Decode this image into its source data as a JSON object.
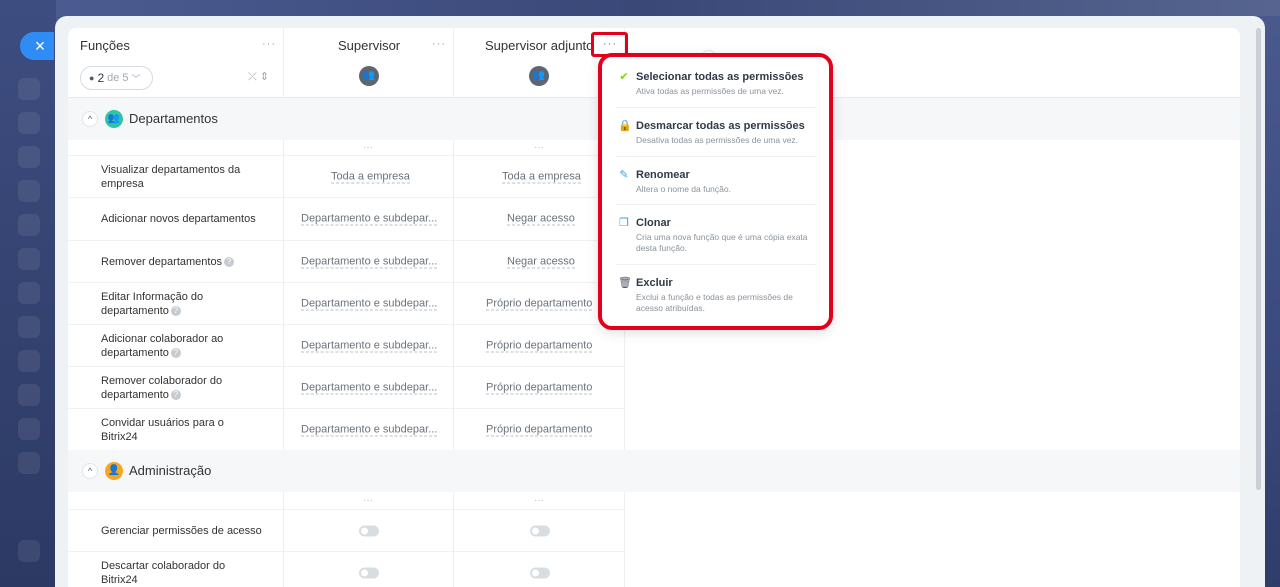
{
  "close_label": "×",
  "functions": {
    "title": "Funções",
    "counter_selected": "2",
    "counter_of": "de 5",
    "dots": "···"
  },
  "roles": [
    {
      "name": "Supervisor",
      "avatar": "people-icon"
    },
    {
      "name": "Supervisor adjunto",
      "avatar": "people-icon"
    }
  ],
  "sections": [
    {
      "label": "Departamentos",
      "icon_color": "#2fc6a4",
      "rows": [
        {
          "label": "Visualizar departamentos da empresa",
          "help": false,
          "values": [
            "Toda a empresa",
            "Toda a empresa"
          ]
        },
        {
          "label": "Adicionar novos departamentos",
          "help": false,
          "values": [
            "Departamento e subdepar...",
            "Negar acesso"
          ]
        },
        {
          "label": "Remover departamentos",
          "help": true,
          "values": [
            "Departamento e subdepar...",
            "Negar acesso"
          ]
        },
        {
          "label": "Editar Informação do departamento",
          "help": true,
          "values": [
            "Departamento e subdepar...",
            "Próprio departamento"
          ]
        },
        {
          "label": "Adicionar colaborador ao departamento",
          "help": true,
          "values": [
            "Departamento e subdepar...",
            "Próprio departamento"
          ]
        },
        {
          "label": "Remover colaborador do departamento",
          "help": true,
          "values": [
            "Departamento e subdepar...",
            "Próprio departamento"
          ]
        },
        {
          "label": "Convidar usuários para o Bitrix24",
          "help": false,
          "values": [
            "Departamento e subdepar...",
            "Próprio departamento"
          ]
        }
      ]
    },
    {
      "label": "Administração",
      "icon_color": "#f6a623",
      "rows": [
        {
          "label": "Gerenciar permissões de acesso",
          "help": false,
          "toggles": [
            false,
            false
          ]
        },
        {
          "label": "Descartar colaborador do Bitrix24",
          "help": false,
          "toggles": [
            false,
            false
          ]
        }
      ]
    }
  ],
  "menu": {
    "items": [
      {
        "icon": "check-icon",
        "color": "#7bd500",
        "title": "Selecionar todas as permissões",
        "desc": "Ativa todas as permissões de uma vez."
      },
      {
        "icon": "lock-icon",
        "color": "#ff3b3b",
        "title": "Desmarcar todas as permissões",
        "desc": "Desativa todas as permissões de uma vez."
      },
      {
        "icon": "pencil-icon",
        "color": "#2fa6e6",
        "title": "Renomear",
        "desc": "Altera o nome da função."
      },
      {
        "icon": "copy-icon",
        "color": "#2fa6e6",
        "title": "Clonar",
        "desc": "Cria uma nova função que é uma cópia exata desta função."
      },
      {
        "icon": "trash-icon",
        "color": "#525c69",
        "title": "Excluir",
        "desc": "Exclui a função e todas as permissões de acesso atribuídas."
      }
    ]
  }
}
